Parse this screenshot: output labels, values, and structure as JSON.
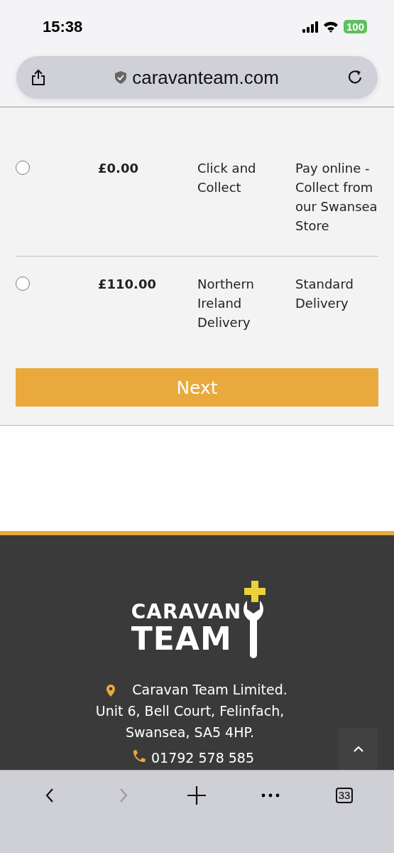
{
  "status_bar": {
    "time": "15:38",
    "battery": "100"
  },
  "address_bar": {
    "url": "caravanteam.com"
  },
  "shipping_options": [
    {
      "selected": false,
      "price": "£0.00",
      "name": "Click and Collect",
      "description": "Pay online - Collect from our Swansea Store"
    },
    {
      "selected": false,
      "price": "£110.00",
      "name": "Northern Ireland Delivery",
      "description": "Standard Delivery"
    }
  ],
  "next_button": "Next",
  "footer": {
    "logo": [
      "CARAVAN",
      "TEAM"
    ],
    "address": [
      "Caravan Team Limited.",
      "Unit 6, Bell Court, Felinfach,",
      "Swansea, SA5 4HP."
    ],
    "phone": "01792 578 585"
  },
  "toolbar": {
    "back_disabled": false,
    "forward_disabled": true,
    "tab_count": "33"
  }
}
